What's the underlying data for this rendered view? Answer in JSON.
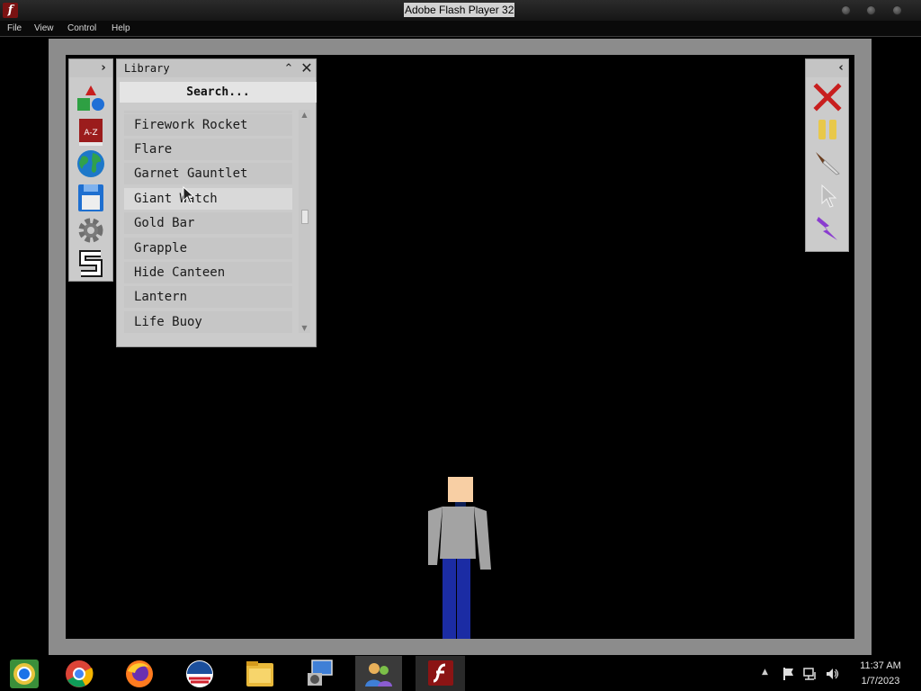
{
  "window": {
    "title": "Adobe Flash Player 32"
  },
  "menu": [
    "File",
    "View",
    "Control",
    "Help"
  ],
  "library": {
    "title": "Library",
    "search_placeholder": "Search...",
    "items": [
      "Firework Rocket",
      "Flare",
      "Garnet Gauntlet",
      "Giant Watch",
      "Gold Bar",
      "Grapple",
      "Hide Canteen",
      "Lantern",
      "Life Buoy"
    ],
    "hovered_item": "Giant Watch"
  },
  "left_toolbar": {
    "tools": [
      {
        "name": "spawn-shapes",
        "icon": "shapes-icon"
      },
      {
        "name": "library-book",
        "icon": "a-z-book-icon"
      },
      {
        "name": "world",
        "icon": "globe-icon"
      },
      {
        "name": "save",
        "icon": "floppy-disk-icon"
      },
      {
        "name": "settings",
        "icon": "gear-icon"
      },
      {
        "name": "mod",
        "icon": "s-logo-icon"
      }
    ],
    "book_label": "A-Z"
  },
  "right_toolbar": {
    "tools": [
      {
        "name": "clear",
        "icon": "red-x-icon"
      },
      {
        "name": "pause",
        "icon": "pause-icon"
      },
      {
        "name": "knife",
        "icon": "knife-icon"
      },
      {
        "name": "select",
        "icon": "cursor-icon"
      },
      {
        "name": "power",
        "icon": "lightning-icon"
      }
    ]
  },
  "taskbar": {
    "apps": [
      "chrome-remote-icon",
      "chrome-icon",
      "firefox-icon",
      "obama-logo-icon",
      "file-explorer-icon",
      "control-panel-icon",
      "people-icon",
      "flash-player-icon"
    ],
    "clock": {
      "time": "11:37 AM",
      "date": "1/7/2023"
    },
    "colors": {
      "active_app": "#3a3a3a",
      "taskbar": "#000000"
    }
  },
  "colors": {
    "stage": "#000000",
    "frame": "#8c8c8c",
    "panel": "#cbcbcb",
    "list_item": "#c6c6c6",
    "list_item_hover": "#d9d9d9",
    "clear_red": "#c81e1e",
    "pause_yellow": "#e8c84a",
    "lightning_purple": "#8a3ccf"
  }
}
